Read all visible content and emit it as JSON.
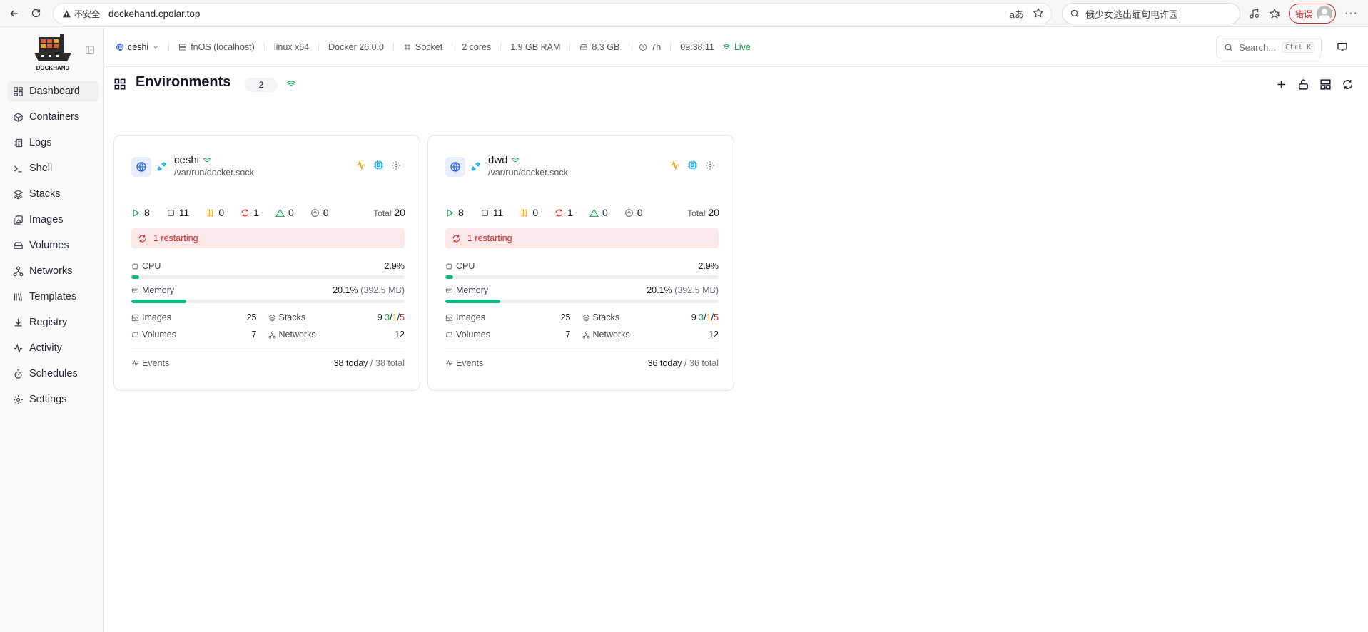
{
  "browser": {
    "security_label": "不安全",
    "url": "dockehand.cpolar.top",
    "search_text": "俄少女逃出缅甸电诈园",
    "error_label": "错误"
  },
  "app": {
    "brand": "DOCKHAND"
  },
  "sidebar": {
    "items": [
      {
        "label": "Dashboard",
        "icon": "dashboard-icon"
      },
      {
        "label": "Containers",
        "icon": "box-icon"
      },
      {
        "label": "Logs",
        "icon": "logs-icon"
      },
      {
        "label": "Shell",
        "icon": "terminal-icon"
      },
      {
        "label": "Stacks",
        "icon": "layers-icon"
      },
      {
        "label": "Images",
        "icon": "images-icon"
      },
      {
        "label": "Volumes",
        "icon": "drive-icon"
      },
      {
        "label": "Networks",
        "icon": "network-icon"
      },
      {
        "label": "Templates",
        "icon": "library-icon"
      },
      {
        "label": "Registry",
        "icon": "download-icon"
      },
      {
        "label": "Activity",
        "icon": "activity-icon"
      },
      {
        "label": "Schedules",
        "icon": "timer-icon"
      },
      {
        "label": "Settings",
        "icon": "gear-icon"
      }
    ]
  },
  "topbar": {
    "env": "ceshi",
    "host": "fnOS (localhost)",
    "platform": "linux x64",
    "docker": "Docker 26.0.0",
    "connection": "Socket",
    "cores": "2 cores",
    "ram": "1.9 GB RAM",
    "disk": "8.3 GB",
    "uptime": "7h",
    "time": "09:38:11",
    "live": "Live",
    "search_placeholder": "Search...",
    "shortcut": "Ctrl K"
  },
  "page": {
    "title": "Environments",
    "count": "2"
  },
  "cards": [
    {
      "name": "ceshi",
      "path": "/var/run/docker.sock",
      "running": "8",
      "stopped": "11",
      "paused": "0",
      "restarting": "1",
      "unhealthy": "0",
      "updates": "0",
      "total_label": "Total",
      "total": "20",
      "banner": "1 restarting",
      "cpu_label": "CPU",
      "cpu_value": "2.9%",
      "cpu_fraction": 0.029,
      "mem_label": "Memory",
      "mem_value": "20.1%",
      "mem_sub": "(392.5 MB)",
      "mem_fraction": 0.201,
      "images_label": "Images",
      "images": "25",
      "stacks_label": "Stacks",
      "stacks_total": "9",
      "stacks_running": "3",
      "stacks_partial": "1",
      "stacks_stopped": "5",
      "volumes_label": "Volumes",
      "volumes": "7",
      "networks_label": "Networks",
      "networks": "12",
      "events_label": "Events",
      "events_today": "38 today",
      "events_total": "/ 38 total"
    },
    {
      "name": "dwd",
      "path": "/var/run/docker.sock",
      "running": "8",
      "stopped": "11",
      "paused": "0",
      "restarting": "1",
      "unhealthy": "0",
      "updates": "0",
      "total_label": "Total",
      "total": "20",
      "banner": "1 restarting",
      "cpu_label": "CPU",
      "cpu_value": "2.9%",
      "cpu_fraction": 0.029,
      "mem_label": "Memory",
      "mem_value": "20.1%",
      "mem_sub": "(392.5 MB)",
      "mem_fraction": 0.201,
      "images_label": "Images",
      "images": "25",
      "stacks_label": "Stacks",
      "stacks_total": "9",
      "stacks_running": "3",
      "stacks_partial": "1",
      "stacks_stopped": "5",
      "volumes_label": "Volumes",
      "volumes": "7",
      "networks_label": "Networks",
      "networks": "12",
      "events_label": "Events",
      "events_today": "36 today",
      "events_total": "/ 36 total"
    }
  ],
  "colors": {
    "accent_green": "#16a34a",
    "bar_green": "#10b981",
    "restart_red": "#dc2626",
    "banner_bg": "#fde8ea",
    "paused_orange": "#f59e0b",
    "cpu_blue": "#0ea5e9"
  }
}
